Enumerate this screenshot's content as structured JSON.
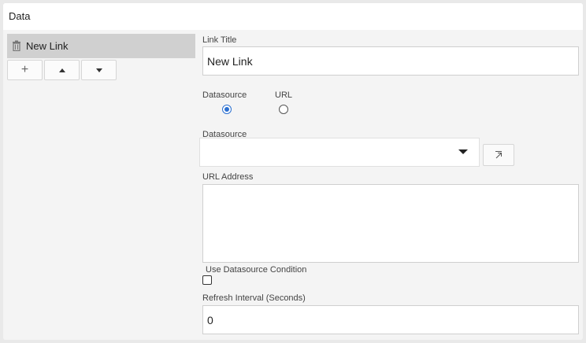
{
  "panel": {
    "title": "Data"
  },
  "link_list": {
    "items": [
      {
        "label": "New Link"
      }
    ],
    "buttons": {
      "add": "+",
      "up": "move-up",
      "down": "move-down"
    }
  },
  "form": {
    "link_title": {
      "label": "Link Title",
      "value": "New Link"
    },
    "source_type": {
      "options": [
        {
          "label": "Datasource",
          "checked": true
        },
        {
          "label": "URL",
          "checked": false
        }
      ]
    },
    "datasource": {
      "label": "Datasource",
      "value": ""
    },
    "url_address": {
      "label": "URL Address",
      "value": ""
    },
    "use_condition": {
      "label": "Use Datasource Condition",
      "checked": false
    },
    "refresh_interval": {
      "label": "Refresh Interval (Seconds)",
      "value": "0"
    }
  },
  "icons": {
    "trash": "trash-icon",
    "open": "open-external-icon",
    "caret": "caret-down-icon"
  },
  "colors": {
    "accent": "#2a6fd0",
    "selected_row": "#d0d0d0"
  }
}
